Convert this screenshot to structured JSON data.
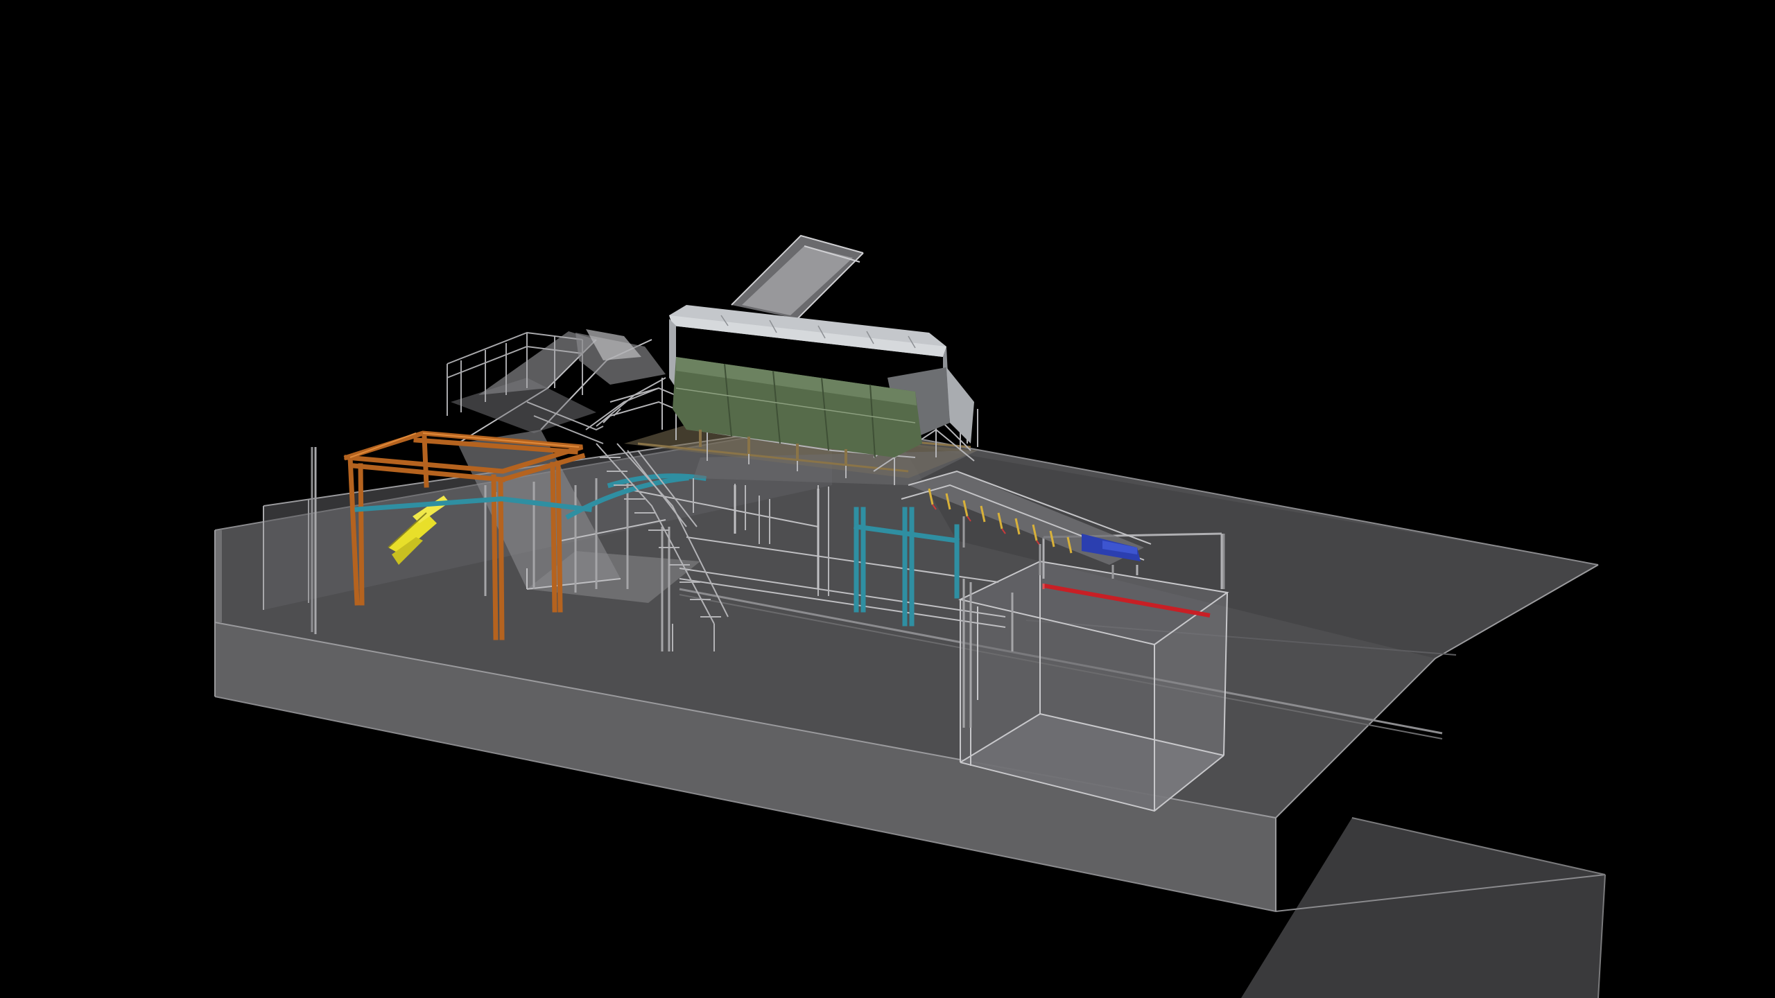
{
  "viewport": {
    "background": "#000000"
  },
  "model": {
    "components": [
      "ground-slab",
      "concrete-pit",
      "feed-conveyor",
      "orange-steel-frame",
      "yellow-hopper",
      "access-stair",
      "upper-platform",
      "trommel-hood",
      "trommel-drum",
      "cyan-support-frame",
      "discharge-conveyor",
      "discharge-bin",
      "red-pipe"
    ],
    "colors": {
      "slab_top": "#5a5a5c",
      "slab_side": "#6c6c6e",
      "slab_far": "#3c3c3e",
      "pit_wall": "#8e8e92",
      "edge": "#b5b5b8",
      "frame_orange": "#b5631f",
      "hopper_yellow": "#e8df2a",
      "support_cyan": "#2f8fa2",
      "drum_green": "#566b4a",
      "hood_grey": "#b9bcc0",
      "rail_grey": "#9a9a9a",
      "conveyor_blue": "#2b3fb0",
      "pipe_red": "#c81f25",
      "platform_brown": "#8a7448"
    }
  }
}
